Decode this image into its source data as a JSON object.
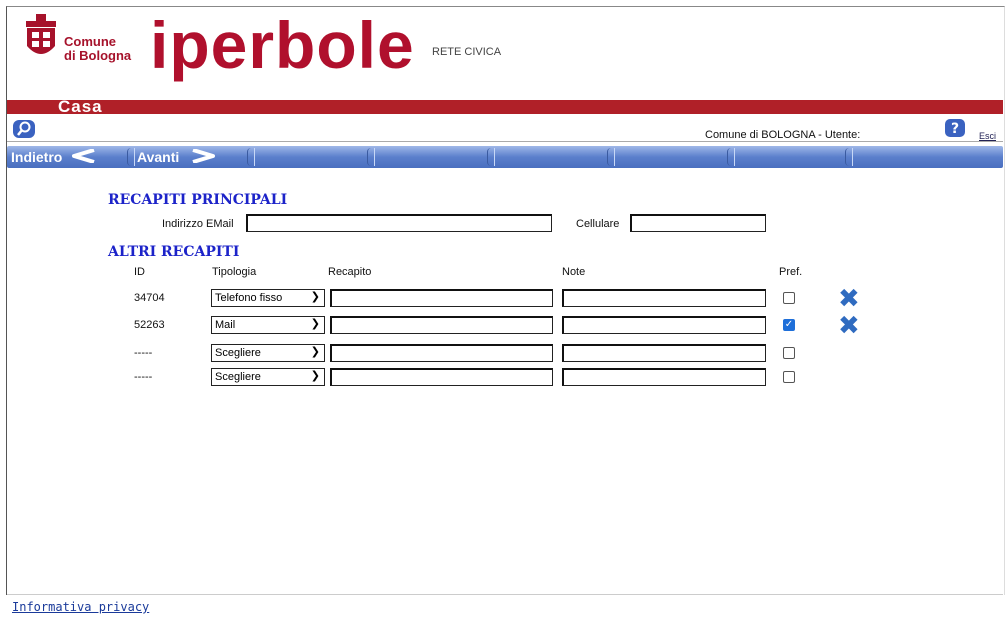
{
  "header": {
    "comune_line1": "Comune",
    "comune_line2": "di Bologna",
    "brand": "iperbole",
    "tagline": "RETE CIVICA",
    "section": "Casa"
  },
  "status": {
    "user_text": "Comune di BOLOGNA - Utente:",
    "logout": "Esci"
  },
  "nav": {
    "back": "Indietro",
    "forward": "Avanti"
  },
  "principali": {
    "title": "RECAPITI PRINCIPALI",
    "email_label": "Indirizzo EMail",
    "email_value": "",
    "cell_label": "Cellulare",
    "cell_value": ""
  },
  "altri": {
    "title": "ALTRI RECAPITI",
    "columns": {
      "id": "ID",
      "tipologia": "Tipologia",
      "recapito": "Recapito",
      "note": "Note",
      "pref": "Pref."
    },
    "rows": [
      {
        "id": "34704",
        "tipologia": "Telefono fisso",
        "recapito": "",
        "note": "",
        "pref": false,
        "deletable": true
      },
      {
        "id": "52263",
        "tipologia": "Mail",
        "recapito": "",
        "note": "",
        "pref": true,
        "deletable": true
      },
      {
        "id": "-----",
        "tipologia": "Scegliere",
        "recapito": "",
        "note": "",
        "pref": false,
        "deletable": false
      },
      {
        "id": "-----",
        "tipologia": "Scegliere",
        "recapito": "",
        "note": "",
        "pref": false,
        "deletable": false
      }
    ]
  },
  "footer": {
    "privacy": "Informativa privacy"
  },
  "colors": {
    "brand_red": "#b0102d",
    "heading_blue": "#1c23c9",
    "nav_blue": "#5b7fcc",
    "delete_blue": "#2f6bc0"
  },
  "icons": [
    "comune-crest-icon",
    "search-icon",
    "help-icon",
    "arrow-left-icon",
    "arrow-right-icon",
    "chevron-down-icon",
    "delete-x-icon",
    "checkmark-icon"
  ]
}
